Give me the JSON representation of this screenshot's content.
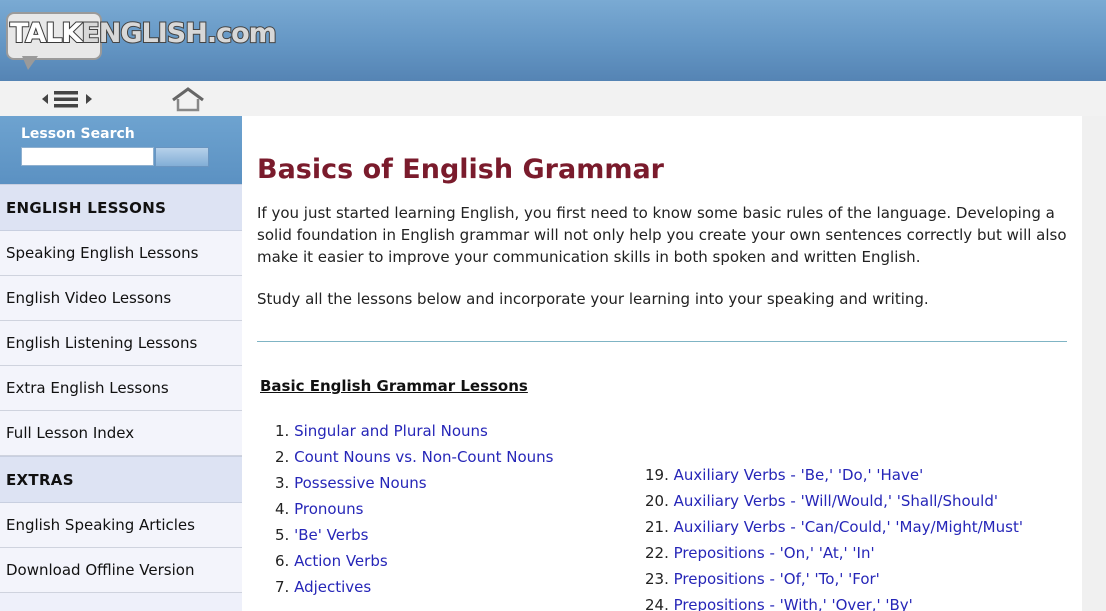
{
  "header": {
    "logo_talk": "TALK",
    "logo_rest": "ENGLISH.com"
  },
  "navbar": {
    "menu_icon": "menu-arrows-icon",
    "home_icon": "home-icon"
  },
  "sidebar": {
    "search_label": "Lesson Search",
    "search_placeholder": "",
    "sections": [
      {
        "heading": "ENGLISH LESSONS",
        "items": [
          "Speaking English Lessons",
          "English Video Lessons",
          "English Listening Lessons",
          "Extra English Lessons",
          "Full Lesson Index"
        ]
      },
      {
        "heading": "EXTRAS",
        "items": [
          "English Speaking Articles",
          "Download Offline Version"
        ]
      }
    ]
  },
  "main": {
    "title": "Basics of English Grammar",
    "intro": "If you just started learning English, you first need to know some basic rules of the language. Developing a solid foundation in English grammar will not only help you create your own sentences correctly but will also make it easier to improve your communication skills in both spoken and written English.",
    "study": "Study all the lessons below and incorporate your learning into your speaking and writing.",
    "section_title": "Basic English Grammar Lessons",
    "lessons_left": [
      {
        "num": "1.",
        "label": "Singular and Plural Nouns"
      },
      {
        "num": "2.",
        "label": "Count Nouns vs. Non-Count Nouns"
      },
      {
        "num": "3.",
        "label": "Possessive Nouns"
      },
      {
        "num": "4.",
        "label": "Pronouns"
      },
      {
        "num": "5.",
        "label": "'Be' Verbs"
      },
      {
        "num": "6.",
        "label": "Action Verbs"
      },
      {
        "num": "7.",
        "label": "Adjectives"
      }
    ],
    "lessons_right": [
      {
        "num": "19.",
        "label": "Auxiliary Verbs - 'Be,' 'Do,' 'Have'"
      },
      {
        "num": "20.",
        "label": "Auxiliary Verbs - 'Will/Would,' 'Shall/Should'"
      },
      {
        "num": "21.",
        "label": "Auxiliary Verbs - 'Can/Could,' 'May/Might/Must'"
      },
      {
        "num": "22.",
        "label": "Prepositions - 'On,' 'At,' 'In'"
      },
      {
        "num": "23.",
        "label": "Prepositions - 'Of,' 'To,' 'For'"
      },
      {
        "num": "24.",
        "label": "Prepositions - 'With,' 'Over,' 'By'"
      }
    ]
  },
  "colors": {
    "header_blue": "#6496c4",
    "title_maroon": "#7a1b2c",
    "link_blue": "#2626b8"
  }
}
